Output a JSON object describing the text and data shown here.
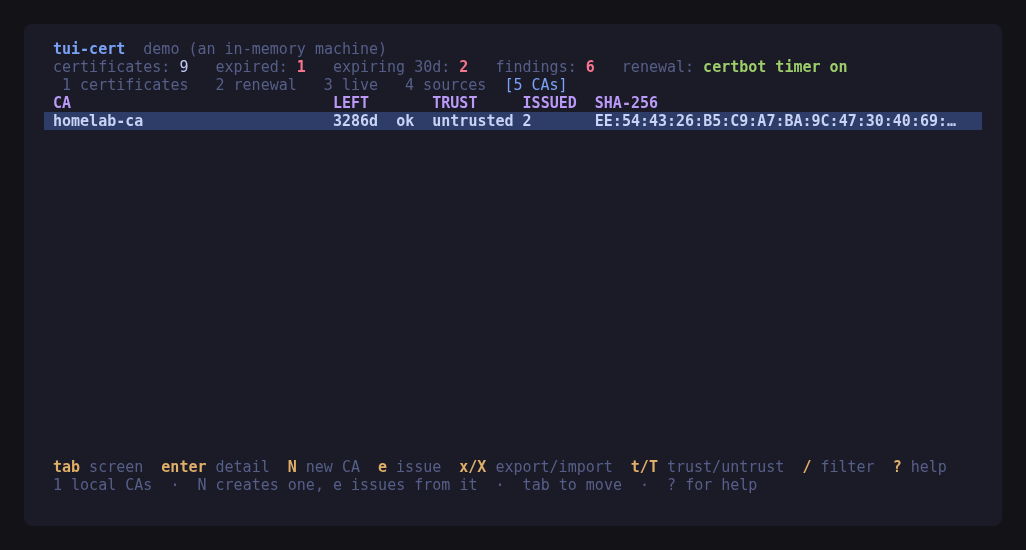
{
  "header": {
    "title": "tui-cert",
    "subtitle": "demo (an in-memory machine)"
  },
  "stats": [
    {
      "label": "certificates:",
      "value": "9",
      "kind": "count"
    },
    {
      "label": "expired:",
      "value": "1",
      "kind": "alert"
    },
    {
      "label": "expiring 30d:",
      "value": "2",
      "kind": "alert"
    },
    {
      "label": "findings:",
      "value": "6",
      "kind": "alert"
    },
    {
      "label": "renewal:",
      "value": "certbot timer on",
      "kind": "good"
    }
  ],
  "tabs": [
    {
      "label": "1 certificates",
      "selected": false
    },
    {
      "label": "2 renewal",
      "selected": false
    },
    {
      "label": "3 live",
      "selected": false
    },
    {
      "label": "4 sources",
      "selected": false
    },
    {
      "label": "[5 CAs]",
      "selected": true
    }
  ],
  "table": {
    "columns": [
      "CA",
      "LEFT",
      "TRUST",
      "ISSUED",
      "SHA-256"
    ],
    "rows": [
      {
        "ca": "homelab-ca",
        "left": "3286d",
        "status": "ok",
        "trust": "untrusted",
        "issued": "2",
        "sha256": "EE:54:43:26:B5:C9:A7:BA:9C:47:30:40:69:…",
        "selected": true
      }
    ]
  },
  "key_hints": [
    {
      "key": "tab",
      "action": "screen"
    },
    {
      "key": "enter",
      "action": "detail"
    },
    {
      "key": "N",
      "action": "new CA"
    },
    {
      "key": "e",
      "action": "issue"
    },
    {
      "key": "x/X",
      "action": "export/import"
    },
    {
      "key": "t/T",
      "action": "trust/untrust"
    },
    {
      "key": "/",
      "action": "filter"
    },
    {
      "key": "?",
      "action": "help"
    }
  ],
  "status_line": "1 local CAs  ·  N creates one, e issues from it  ·  tab to move  ·  ? for help"
}
